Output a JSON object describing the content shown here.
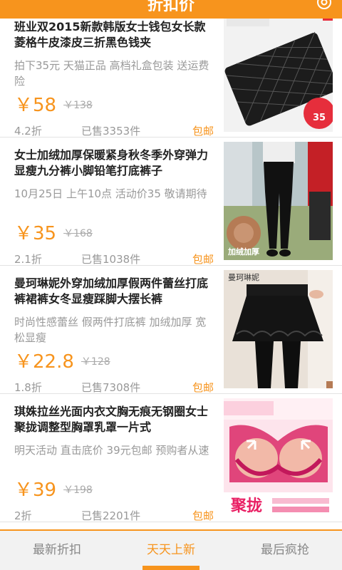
{
  "header": {
    "title": "折扣价",
    "settings_icon": "gear-icon"
  },
  "colors": {
    "accent": "#f7941d"
  },
  "products": [
    {
      "name": "班业双2015新款韩版女士钱包女长款菱格牛皮漆皮三折黑色钱夹",
      "desc": "拍下35元 天猫正品 高档礼盒包装 送运费险",
      "price": "￥58",
      "old_price": "￥138",
      "discount": "4.2折",
      "sold": "已售3353件",
      "shipping": "包邮",
      "image_label": "35"
    },
    {
      "name": "女士加绒加厚保暖紧身秋冬季外穿弹力显瘦九分裤小脚铅笔打底裤子",
      "desc": "10月25日 上午10点 活动价35 敬请期待",
      "price": "￥35",
      "old_price": "￥168",
      "discount": "2.1折",
      "sold": "已售1038件",
      "shipping": "包邮",
      "image_label": "加绒加厚"
    },
    {
      "name": "曼珂琳妮外穿加绒加厚假两件蕾丝打底裤裙裤女冬显瘦踩脚大摆长裤",
      "desc": "时尚性感蕾丝 假两件打底裤 加绒加厚 宽松显瘦",
      "price": "￥22.8",
      "old_price": "￥128",
      "discount": "1.8折",
      "sold": "已售7308件",
      "shipping": "包邮",
      "image_label": "曼珂琳妮"
    },
    {
      "name": "琪姝拉丝光面内衣文胸无痕无钢圈女士聚拢调整型胸罩乳罩一片式",
      "desc": "明天活动 直击底价 39元包邮 预购者从速",
      "price": "￥39",
      "old_price": "￥198",
      "discount": "2折",
      "sold": "已售2201件",
      "shipping": "包邮",
      "image_label": "聚拢"
    }
  ],
  "tabs": [
    {
      "label": "最新折扣",
      "active": false
    },
    {
      "label": "天天上新",
      "active": true
    },
    {
      "label": "最后疯抢",
      "active": false
    }
  ]
}
